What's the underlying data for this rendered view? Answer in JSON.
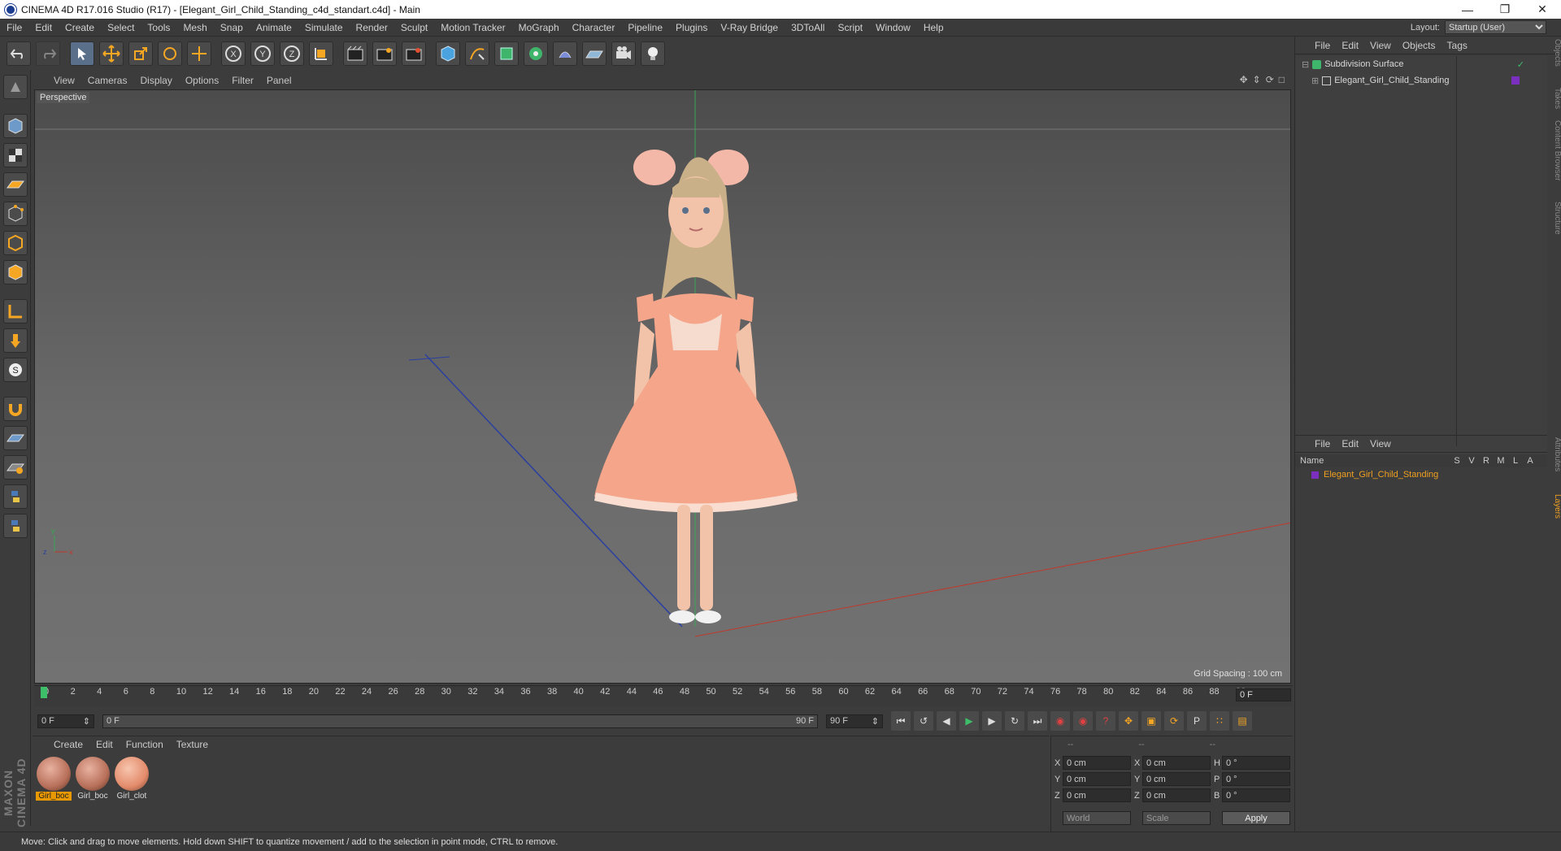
{
  "window": {
    "title": "CINEMA 4D R17.016 Studio (R17) - [Elegant_Girl_Child_Standing_c4d_standart.c4d] - Main"
  },
  "menu": [
    "File",
    "Edit",
    "Create",
    "Select",
    "Tools",
    "Mesh",
    "Snap",
    "Animate",
    "Simulate",
    "Render",
    "Sculpt",
    "Motion Tracker",
    "MoGraph",
    "Character",
    "Pipeline",
    "Plugins",
    "V-Ray Bridge",
    "3DToAll",
    "Script",
    "Window",
    "Help"
  ],
  "layout": {
    "label": "Layout:",
    "value": "Startup (User)"
  },
  "viewport": {
    "menu": [
      "View",
      "Cameras",
      "Display",
      "Options",
      "Filter",
      "Panel"
    ],
    "name": "Perspective",
    "grid_spacing": "Grid Spacing : 100 cm"
  },
  "timeline": {
    "ticks": [
      "0",
      "2",
      "4",
      "6",
      "8",
      "10",
      "12",
      "14",
      "16",
      "18",
      "20",
      "22",
      "24",
      "26",
      "28",
      "30",
      "32",
      "34",
      "36",
      "38",
      "40",
      "42",
      "44",
      "46",
      "48",
      "50",
      "52",
      "54",
      "56",
      "58",
      "60",
      "62",
      "64",
      "66",
      "68",
      "70",
      "72",
      "74",
      "76",
      "78",
      "80",
      "82",
      "84",
      "86",
      "88",
      "90"
    ],
    "current": "0 F",
    "start": "0 F",
    "range_start": "0 F",
    "range_end": "90 F",
    "end": "90 F"
  },
  "materials": {
    "menu": [
      "Create",
      "Edit",
      "Function",
      "Texture"
    ],
    "items": [
      {
        "label": "Girl_boc",
        "selected": true
      },
      {
        "label": "Girl_boc",
        "selected": false
      },
      {
        "label": "Girl_clot",
        "selected": false
      }
    ]
  },
  "coords": {
    "header": [
      "--",
      "--",
      "--"
    ],
    "rows": [
      {
        "a": "X",
        "av": "0 cm",
        "b": "X",
        "bv": "0 cm",
        "c": "H",
        "cv": "0 °"
      },
      {
        "a": "Y",
        "av": "0 cm",
        "b": "Y",
        "bv": "0 cm",
        "c": "P",
        "cv": "0 °"
      },
      {
        "a": "Z",
        "av": "0 cm",
        "b": "Z",
        "bv": "0 cm",
        "c": "B",
        "cv": "0 °"
      }
    ],
    "world": "World",
    "scale": "Scale",
    "apply": "Apply"
  },
  "objects": {
    "menu": [
      "File",
      "Edit",
      "View",
      "Objects",
      "Tags"
    ],
    "items": [
      {
        "name": "Subdivision Surface"
      },
      {
        "name": "Elegant_Girl_Child_Standing"
      }
    ]
  },
  "layers": {
    "menu": [
      "File",
      "Edit",
      "View"
    ],
    "headers": [
      "Name",
      "S",
      "V",
      "R",
      "M",
      "L",
      "A"
    ],
    "row": "Elegant_Girl_Child_Standing"
  },
  "side_tabs": [
    "Objects",
    "Takes",
    "Content Browser",
    "Structure",
    "Attributes",
    "Layers"
  ],
  "status": "Move: Click and drag to move elements. Hold down SHIFT to quantize movement / add to the selection in point mode, CTRL to remove.",
  "brand": "MAXON CINEMA 4D",
  "colors": {
    "accent": "#e89800",
    "dress": "#f4a58a",
    "axis_x": "#c0392b",
    "axis_y": "#3aa655",
    "axis_z": "#2a3fa0"
  }
}
